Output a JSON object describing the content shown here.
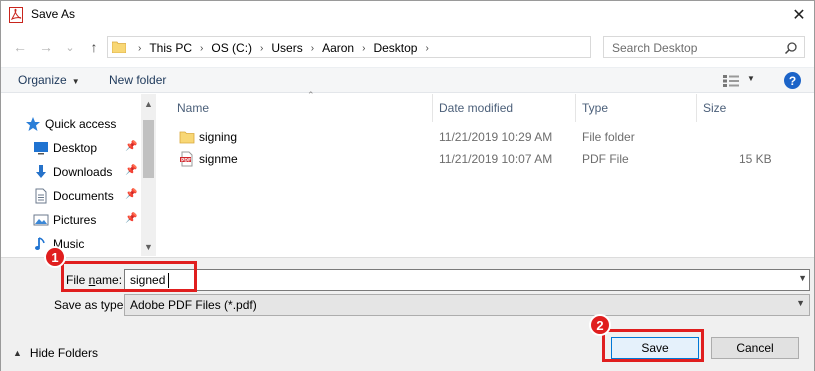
{
  "window": {
    "title": "Save As",
    "close_glyph": "✕"
  },
  "nav_buttons": {
    "back": "←",
    "forward": "→",
    "recent": "⌄",
    "up": "↑"
  },
  "address": {
    "crumbs": [
      "This PC",
      "OS (C:)",
      "Users",
      "Aaron",
      "Desktop"
    ],
    "separator": "›"
  },
  "search": {
    "placeholder": "Search Desktop"
  },
  "toolbar": {
    "organize": "Organize",
    "new_folder": "New folder",
    "help": "?"
  },
  "navpane": {
    "items": [
      {
        "label": "Quick access",
        "icon": "star-icon",
        "pinned": false
      },
      {
        "label": "Desktop",
        "icon": "desktop-icon",
        "pinned": true
      },
      {
        "label": "Downloads",
        "icon": "download-icon",
        "pinned": true
      },
      {
        "label": "Documents",
        "icon": "documents-icon",
        "pinned": true
      },
      {
        "label": "Pictures",
        "icon": "pictures-icon",
        "pinned": true
      },
      {
        "label": "Music",
        "icon": "music-icon",
        "pinned": false
      }
    ]
  },
  "filelist": {
    "columns": [
      "Name",
      "Date modified",
      "Type",
      "Size"
    ],
    "rows": [
      {
        "name": "signing",
        "date": "11/21/2019 10:29 AM",
        "type": "File folder",
        "size": "",
        "icon": "folder-icon"
      },
      {
        "name": "signme",
        "date": "11/21/2019 10:07 AM",
        "type": "PDF File",
        "size": "15 KB",
        "icon": "pdf-file-icon"
      }
    ]
  },
  "form": {
    "file_name_label_prefix": "File ",
    "file_name_label_underlined": "n",
    "file_name_label_suffix": "ame:",
    "file_name_value": "signed",
    "save_as_type_label": "Save as type:",
    "save_as_type_value": "Adobe PDF Files (*.pdf)"
  },
  "footer": {
    "hide_folders": "Hide Folders",
    "save": "Save",
    "cancel": "Cancel"
  },
  "annotations": {
    "badge_1": "1",
    "badge_2": "2",
    "color": "#e01e1e"
  }
}
